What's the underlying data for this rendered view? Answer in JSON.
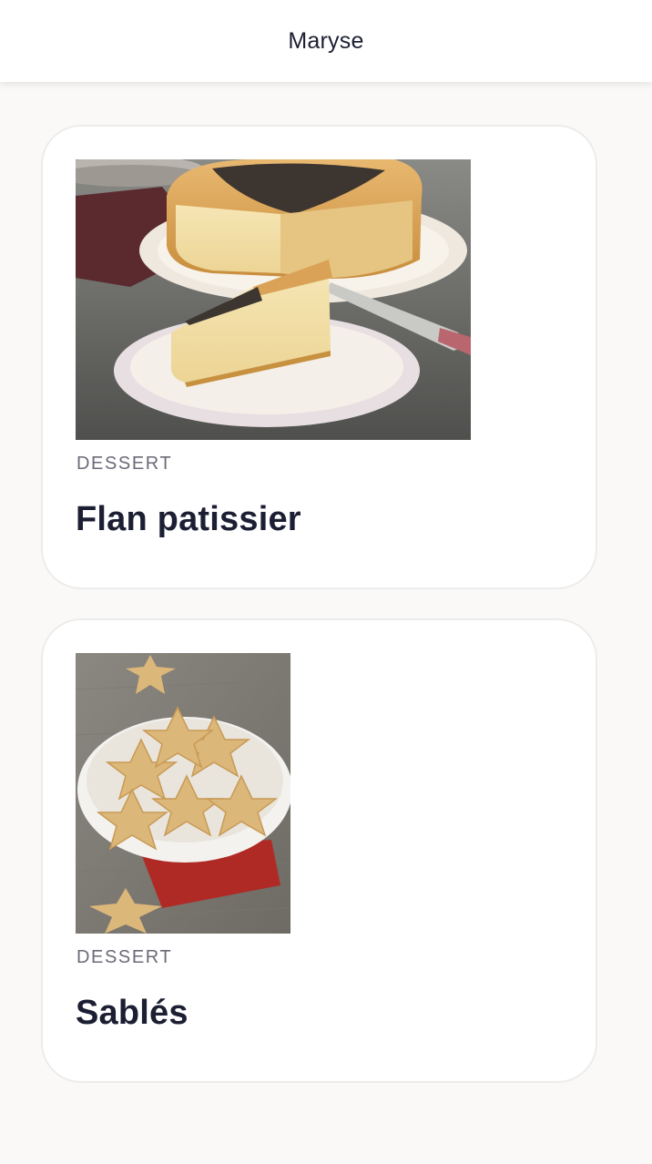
{
  "header": {
    "title": "Maryse"
  },
  "recipes": [
    {
      "category": "DESSERT",
      "title": "Flan patissier",
      "image_icon": "flan-photo"
    },
    {
      "category": "DESSERT",
      "title": "Sablés",
      "image_icon": "star-cookies-photo"
    }
  ],
  "colors": {
    "header_bg": "#ffffff",
    "page_bg": "#faf9f7",
    "title_text": "#1c1f33",
    "category_text": "#6b6b78",
    "card_border": "#ececec"
  }
}
